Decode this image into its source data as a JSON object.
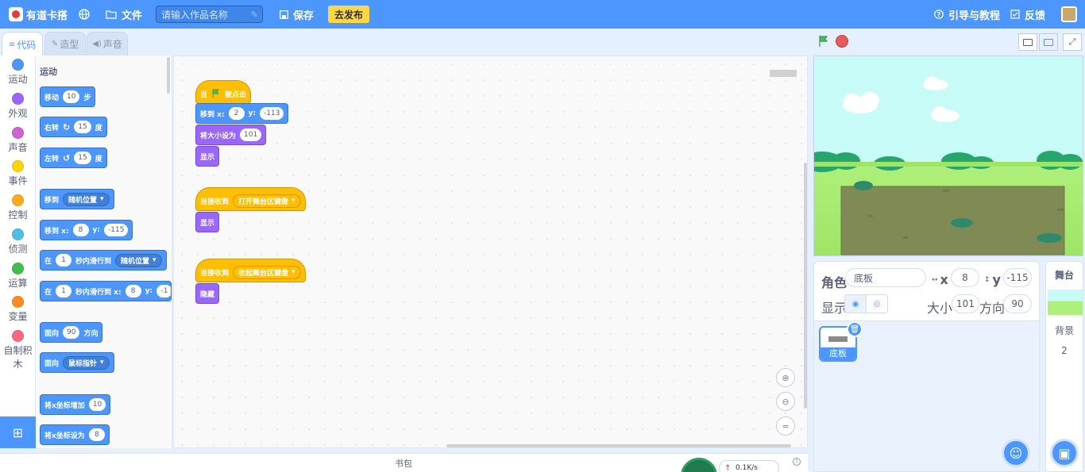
{
  "menubar": {
    "brand": "有道卡搭",
    "file": "文件",
    "title_placeholder": "请输入作品名称",
    "save": "保存",
    "publish": "去发布",
    "guide": "引导与教程",
    "feedback": "反馈"
  },
  "tabs": [
    {
      "label": "代码",
      "icon": "code-icon"
    },
    {
      "label": "造型",
      "icon": "brush-icon"
    },
    {
      "label": "声音",
      "icon": "speaker-icon"
    }
  ],
  "categories": [
    {
      "label": "运动",
      "color": "#4c97ff"
    },
    {
      "label": "外观",
      "color": "#9966ff"
    },
    {
      "label": "声音",
      "color": "#cf63cf"
    },
    {
      "label": "事件",
      "color": "#ffd500"
    },
    {
      "label": "控制",
      "color": "#ffab19"
    },
    {
      "label": "侦测",
      "color": "#4cbfe6"
    },
    {
      "label": "运算",
      "color": "#40bf4a"
    },
    {
      "label": "变量",
      "color": "#ff8c1a"
    },
    {
      "label": "自制积",
      "label2": "木",
      "color": "#ff6680"
    }
  ],
  "palette": {
    "section": "运动",
    "move": {
      "pre": "移动",
      "val": "10",
      "post": "步"
    },
    "turn_right": {
      "pre": "右转",
      "val": "15",
      "post": "度"
    },
    "turn_left": {
      "pre": "左转",
      "val": "15",
      "post": "度"
    },
    "goto": {
      "pre": "移到",
      "dd": "随机位置"
    },
    "goto_xy": {
      "pre": "移到 x:",
      "x": "8",
      "ylabel": "y:",
      "y": "-115"
    },
    "glide": {
      "pre": "在",
      "val": "1",
      "mid": "秒内滑行到",
      "dd": "随机位置"
    },
    "glide_xy": {
      "pre": "在",
      "val": "1",
      "mid": "秒内滑行到 x:",
      "x": "8",
      "ylabel": "y:",
      "y": "-1"
    },
    "point_dir": {
      "pre": "面向",
      "val": "90",
      "post": "方向"
    },
    "point_towards": {
      "pre": "面向",
      "dd": "鼠标指针"
    },
    "change_x": {
      "pre": "将x坐标增加",
      "val": "10"
    },
    "set_x": {
      "pre": "将x坐标设为",
      "val": "8"
    }
  },
  "scripts": {
    "s1_hat": {
      "pre": "当",
      "post": "被点击"
    },
    "s1_goto": {
      "pre": "移到 x:",
      "x": "2",
      "ylabel": "y:",
      "y": "-113"
    },
    "s1_size": {
      "pre": "将大小设为",
      "val": "101"
    },
    "s1_show": "显示",
    "s2_hat": {
      "pre": "当接收到",
      "dd": "打开舞台区键盘"
    },
    "s2_show": "显示",
    "s3_hat": {
      "pre": "当接收到",
      "dd": "收起舞台区键盘"
    },
    "s3_hide": "隐藏"
  },
  "zoom": {
    "in": "⊕",
    "out": "⊖",
    "reset": "="
  },
  "backpack": "书包",
  "network": {
    "speed": "0.1K/s",
    "arrow": "↑"
  },
  "sprite": {
    "label": "角色",
    "name": "底板",
    "x_label": "x",
    "x": "8",
    "y_label": "y",
    "y": "-115",
    "show_label": "显示",
    "size_label": "大小",
    "size": "101",
    "dir_label": "方向",
    "dir": "90",
    "tile_name": "底板"
  },
  "stage_pane": {
    "title": "舞台",
    "bg_label": "背景",
    "bg_count": "2"
  },
  "colors": {
    "brand": "#4c97ff",
    "motion": "#4c97ff",
    "looks": "#9966ff",
    "event": "#ffbf00",
    "publish": "#ffd741"
  }
}
